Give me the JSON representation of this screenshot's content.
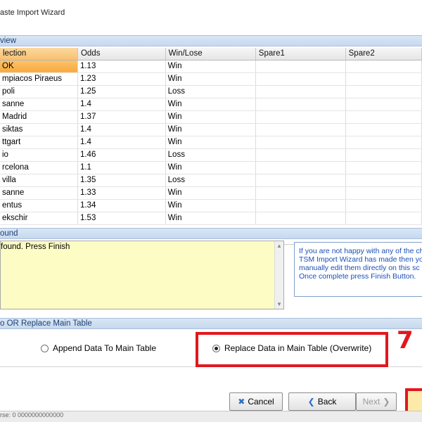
{
  "window": {
    "title": "aste Import Wizard"
  },
  "preview": {
    "header": "view",
    "columns": [
      "lection",
      "Odds",
      "Win/Lose",
      "Spare1",
      "Spare2"
    ],
    "rows": [
      [
        "OK",
        "1.13",
        "Win"
      ],
      [
        "mpiacos Piraeus",
        "1.23",
        "Win"
      ],
      [
        "poli",
        "1.25",
        "Loss"
      ],
      [
        "sanne",
        "1.4",
        "Win"
      ],
      [
        " Madrid",
        "1.37",
        "Win"
      ],
      [
        "siktas",
        "1.4",
        "Win"
      ],
      [
        "ttgart",
        "1.4",
        "Win"
      ],
      [
        "io",
        "1.46",
        "Loss"
      ],
      [
        "rcelona",
        "1.1",
        "Win"
      ],
      [
        "villa",
        "1.35",
        "Loss"
      ],
      [
        "sanne",
        "1.33",
        "Win"
      ],
      [
        "entus",
        "1.34",
        "Win"
      ],
      [
        "ekschir",
        "1.53",
        "Win"
      ]
    ]
  },
  "problems": {
    "header": "ound",
    "text": "found. Press Finish"
  },
  "help": {
    "lines": [
      "If you are not happy with any of the ch",
      "TSM Import Wizard has made then yo",
      "manually edit them directly on this sc",
      "Once complete press Finish Button."
    ]
  },
  "mode": {
    "header": "o OR Replace Main Table",
    "append_label": "Append Data To Main Table",
    "replace_label": "Replace Data in Main Table (Overwrite)",
    "selected": "replace"
  },
  "annotation": {
    "step_number": "7",
    "color": "#e2171e"
  },
  "buttons": {
    "cancel": "Cancel",
    "back": "Back",
    "next": "Next"
  },
  "status_strip": "rse: 0 0000000000000"
}
